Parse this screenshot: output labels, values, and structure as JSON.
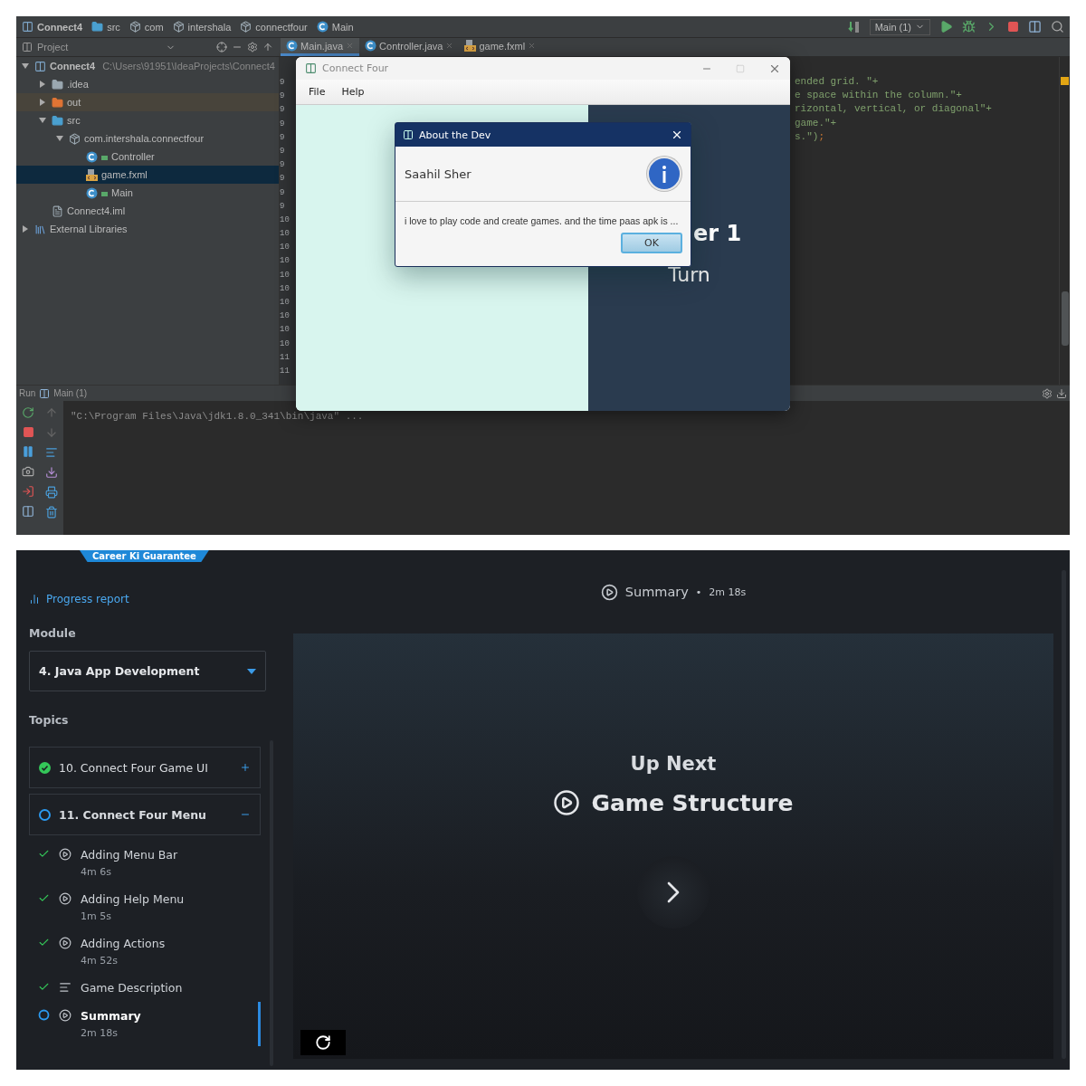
{
  "ide": {
    "breadcrumbs": [
      {
        "label": "Connect4",
        "kind": "module"
      },
      {
        "label": "src",
        "kind": "source"
      },
      {
        "label": "com",
        "kind": "package"
      },
      {
        "label": "intershala",
        "kind": "package"
      },
      {
        "label": "connectfour",
        "kind": "package"
      },
      {
        "label": "Main",
        "kind": "class"
      }
    ],
    "run_config": "Main (1)",
    "project_panel": {
      "title": "Project"
    },
    "editor_tabs": [
      {
        "label": "Main.java",
        "kind": "class",
        "selected": true
      },
      {
        "label": "Controller.java",
        "kind": "class",
        "selected": false
      },
      {
        "label": "game.fxml",
        "kind": "fxml",
        "selected": false
      }
    ],
    "tree": [
      {
        "label": "Connect4",
        "path": "C:\\Users\\91951\\IdeaProjects\\Connect4",
        "kind": "module",
        "expanded": true,
        "selected": false,
        "children": [
          {
            "label": ".idea",
            "kind": "folder",
            "expanded": false,
            "selected": false
          },
          {
            "label": "out",
            "kind": "excluded",
            "expanded": false,
            "selected": false
          },
          {
            "label": "src",
            "kind": "source",
            "expanded": true,
            "selected": false,
            "children": [
              {
                "label": "com.intershala.connectfour",
                "kind": "package",
                "expanded": true,
                "selected": false,
                "children": [
                  {
                    "label": "Controller",
                    "kind": "class",
                    "selected": false
                  },
                  {
                    "label": "game.fxml",
                    "kind": "fxml",
                    "selected": true
                  },
                  {
                    "label": "Main",
                    "kind": "class",
                    "selected": false
                  }
                ]
              }
            ]
          },
          {
            "label": "Connect4.iml",
            "kind": "file",
            "selected": false
          }
        ]
      },
      {
        "label": "External Libraries",
        "kind": "library",
        "expanded": false,
        "selected": false
      }
    ],
    "gutter": [
      "9",
      "9",
      "9",
      "9",
      "9",
      "9",
      "9",
      "9",
      "9",
      "9",
      "10",
      "10",
      "10",
      "10",
      "10",
      "10",
      "10",
      "10",
      "10",
      "10",
      "11",
      "11"
    ],
    "code_lines": [
      {
        "text": "ended grid. \"+"
      },
      {
        "text": "e space within the column.\"+"
      },
      {
        "text": "rizontal, vertical, or diagonal\"+"
      },
      {
        "text": "game.\"+"
      },
      {
        "text": "s.\")",
        "end": ";"
      }
    ],
    "run": {
      "title": "Run",
      "config": "Main (1)",
      "console": "\"C:\\Program Files\\Java\\jdk1.8.0_341\\bin\\java\" ..."
    },
    "app_window": {
      "title": "Connect Four",
      "menus": [
        "File",
        "Help"
      ],
      "turn_label": "er 1",
      "turn_caption": "Turn",
      "dialog": {
        "title": "About the Dev",
        "header": "Saahil Sher",
        "content": "i love to play code and create games. and the time paas apk is ...",
        "button": "OK"
      }
    }
  },
  "course": {
    "badge": "Career Ki Guarantee",
    "progress_link": "Progress report",
    "module_label": "Module",
    "module": "4. Java App Development",
    "topics_label": "Topics",
    "topics": [
      {
        "title": "10. Connect Four Game UI",
        "done": true,
        "expanded": false
      },
      {
        "title": "11. Connect Four Menu",
        "done": false,
        "expanded": true,
        "lessons": [
          {
            "title": "Adding Menu Bar",
            "duration": "4m 6s",
            "kind": "video",
            "done": true,
            "selected": false
          },
          {
            "title": "Adding Help Menu",
            "duration": "1m 5s",
            "kind": "video",
            "done": true,
            "selected": false
          },
          {
            "title": "Adding Actions",
            "duration": "4m 52s",
            "kind": "video",
            "done": true,
            "selected": false
          },
          {
            "title": "Game Description",
            "kind": "text",
            "done": true,
            "selected": false
          },
          {
            "title": "Summary",
            "duration": "2m 18s",
            "kind": "video",
            "done": false,
            "selected": true
          }
        ]
      }
    ],
    "player": {
      "title": "Summary",
      "separator": "•",
      "duration": "2m 18s",
      "up_next_label": "Up Next",
      "up_next_title": "Game Structure"
    }
  }
}
